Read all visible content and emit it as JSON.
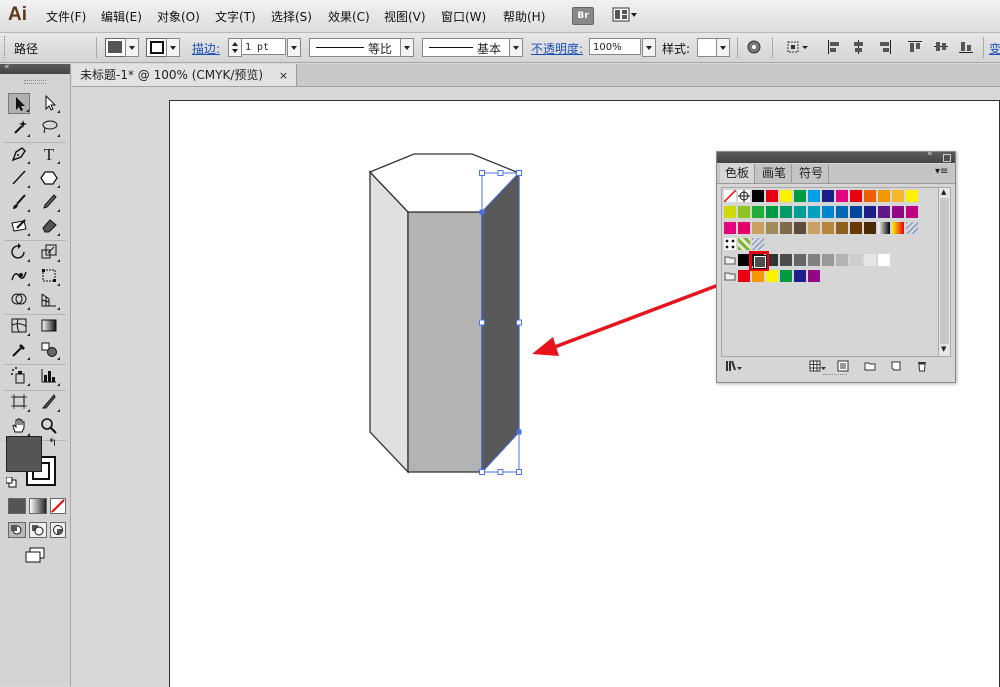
{
  "app": {
    "logo": "Ai"
  },
  "menu": [
    "文件(F)",
    "编辑(E)",
    "对象(O)",
    "文字(T)",
    "选择(S)",
    "效果(C)",
    "视图(V)",
    "窗口(W)",
    "帮助(H)"
  ],
  "menu_extra": {
    "bridge": "Br"
  },
  "control": {
    "selection_type": "路径",
    "stroke_label": "描边:",
    "stroke_weight": "1 pt",
    "profile_label": "等比",
    "brush_label": "基本",
    "opacity_label": "不透明度:",
    "opacity_value": "100%",
    "style_label": "样式:",
    "transform_label": "变"
  },
  "document": {
    "tab_title": "未标题-1* @ 100% (CMYK/预览)",
    "close": "×"
  },
  "swatch_panel": {
    "tabs": [
      "色板",
      "画笔",
      "符号"
    ],
    "active_tab": "色板",
    "rows": [
      [
        "#ffffff",
        "#ffffff",
        "#000000",
        "#e60012",
        "#fff100",
        "#009944",
        "#00a0e9",
        "#1d2088",
        "#e4007f",
        "#e60012",
        "#eb6100",
        "#f39800",
        "#f8b62d",
        "#fff100"
      ],
      [
        "#cfdb00",
        "#8fc31f",
        "#22ac38",
        "#009944",
        "#009b6b",
        "#009e96",
        "#00a0c1",
        "#0086d1",
        "#0068b7",
        "#00479d",
        "#1d2088",
        "#601986",
        "#920783",
        "#be0081"
      ],
      [
        "#e4007f",
        "#e5006a",
        "#c9a063",
        "#a18b5c",
        "#7d6b4c",
        "#5e4d3b",
        "#c8a165",
        "#b4853b",
        "#8f5f1e",
        "#6a3906",
        "#4b2a07",
        "#gradient-bw",
        "#gradient-warm",
        "#pattern"
      ],
      [
        "#pattern-dots",
        "#pattern-leaf",
        "#pattern-texture"
      ],
      [
        "#folder",
        "#000000",
        "#1a1a1a",
        "#333333",
        "#4d4d4d",
        "#666666",
        "#808080",
        "#999999",
        "#b3b3b3",
        "#cccccc",
        "#e6e6e6",
        "#ffffff"
      ],
      [
        "#folder",
        "#e60012",
        "#f39800",
        "#fff100",
        "#009944",
        "#1d2088",
        "#920783"
      ]
    ],
    "highlight_color": "#e60012",
    "selected_swatch_color": "#4d4d4d"
  },
  "colors": {
    "fill": "#555555",
    "stroke": "#000000",
    "shape_left": "#e0e0e0",
    "shape_middle": "#b3b3b3",
    "shape_right": "#595959",
    "selection": "#4a73e8",
    "arrow": "#e8141c"
  }
}
